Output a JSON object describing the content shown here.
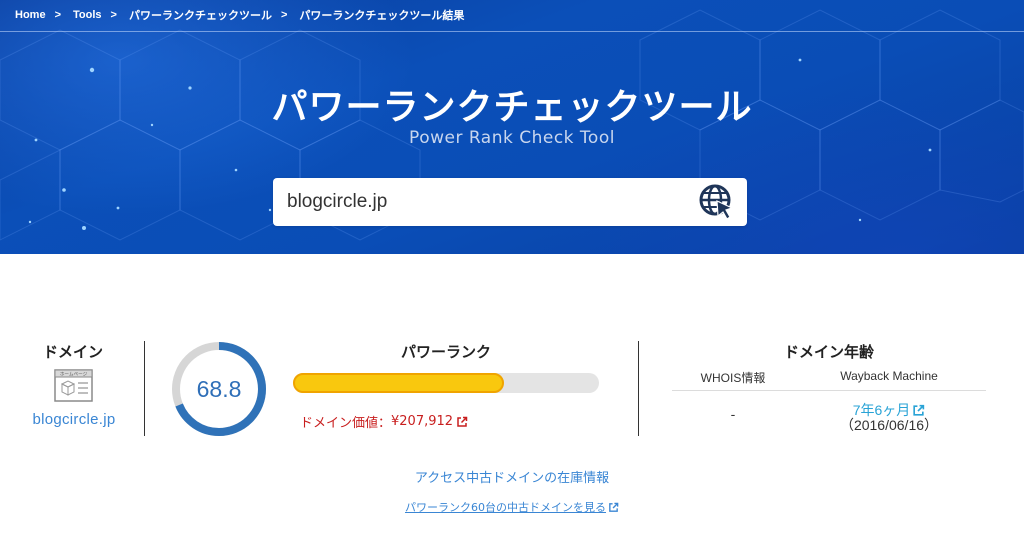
{
  "breadcrumb": [
    "Home",
    "Tools",
    "パワーランクチェックツール",
    "パワーランクチェックツール結果"
  ],
  "breadcrumb_separator": ">",
  "hero": {
    "title": "パワーランクチェックツール",
    "subtitle": "Power Rank Check Tool"
  },
  "search": {
    "value": "blogcircle.jp",
    "button_icon": "globe-cursor-icon"
  },
  "domain": {
    "heading": "ドメイン",
    "icon": "homepage-window-icon",
    "icon_caption": "ホームページ",
    "link": "blogcircle.jp"
  },
  "power_rank": {
    "heading": "パワーランク",
    "score": "68.8",
    "gauge_fraction": 0.688,
    "bar_fraction": 0.688,
    "value_label": "ドメイン価値：",
    "value": "¥207,912"
  },
  "domain_age": {
    "heading": "ドメイン年齢",
    "col_whois": "WHOIS情報",
    "col_wayback": "Wayback Machine",
    "whois_value": "-",
    "wayback_age": "7年6ヶ月",
    "wayback_date": "（2016/06/16）"
  },
  "links": {
    "access_label": "アクセス中古ドメインの在庫情報",
    "used_domains": "パワーランク60台の中古ドメインを見る"
  },
  "colors": {
    "hero_blue": "#0b4fb8",
    "link_blue": "#3a86d4",
    "wayback_blue": "#29a3d6",
    "gauge_blue": "#2f6fb8",
    "bar_yellow": "#f9c80e",
    "value_red": "#c81e1e"
  }
}
